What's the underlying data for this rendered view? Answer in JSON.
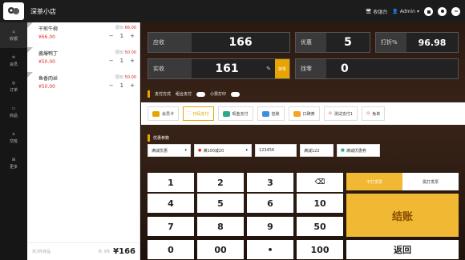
{
  "header": {
    "shop_name": "深茶小店",
    "right_items": [
      "收银台",
      "Admin"
    ]
  },
  "nav": [
    {
      "icon": "cashier-icon",
      "label": "收银"
    },
    {
      "icon": "member-icon",
      "label": "会员"
    },
    {
      "icon": "orders-icon",
      "label": "订单"
    },
    {
      "icon": "goods-icon",
      "label": "商品"
    },
    {
      "icon": "staff-icon",
      "label": "交班"
    },
    {
      "icon": "more-icon",
      "label": "更多"
    }
  ],
  "orders": {
    "items": [
      {
        "name": "干煎牛柳",
        "price": "¥66.00",
        "orig_label": "原价:",
        "orig_price": "66.00",
        "qty": "1"
      },
      {
        "name": "酱爆鸭丁",
        "price": "¥50.00",
        "orig_label": "原价:",
        "orig_price": "50.00",
        "qty": "1"
      },
      {
        "name": "鱼香肉丝",
        "price": "¥50.00",
        "orig_label": "原价:",
        "orig_price": "50.00",
        "qty": "1"
      }
    ],
    "footer_label": "共3件商品",
    "footer_count": "共 3件",
    "total": "¥166"
  },
  "summary": {
    "receivable_label": "应收",
    "receivable_value": "166",
    "discount_label": "优惠",
    "discount_value": "5",
    "rate_label": "打折%",
    "rate_value": "96.98",
    "received_label": "实收",
    "received_value": "161",
    "erase_label": "抹零",
    "change_label": "找零",
    "change_value": "0"
  },
  "payment": {
    "title": "支付方式",
    "combo_label": "组合支付",
    "small_label": "小票打印",
    "methods": [
      {
        "label": "会员卡",
        "color": "#e8a400",
        "active": false
      },
      {
        "label": "扫码支付",
        "color": "#e8a400",
        "active": true
      },
      {
        "label": "现金支付",
        "color": "#2aa98b",
        "active": false
      },
      {
        "label": "挂账",
        "color": "#3b8fe0",
        "active": false
      },
      {
        "label": "口碑券",
        "color": "#f3a623",
        "active": false
      },
      {
        "label": "测试支付1",
        "color": "#e02a2a",
        "active": false
      },
      {
        "label": "免单",
        "color": "#e02a2a",
        "active": false
      }
    ]
  },
  "params": {
    "title": "优惠参数",
    "items": [
      "满减优惠",
      "满100减20",
      "123456",
      "满减122",
      "满减优惠券"
    ]
  },
  "keypad": {
    "rows": [
      [
        "1",
        "2",
        "3",
        "⌫"
      ],
      [
        "4",
        "5",
        "6",
        "10"
      ],
      [
        "7",
        "8",
        "9",
        "50"
      ],
      [
        "0",
        "00",
        "•",
        "100"
      ]
    ]
  },
  "actions": {
    "print_no": "不打发票",
    "print_yes": "需打发票",
    "checkout": "结账",
    "back": "返回"
  },
  "colors": {
    "accent": "#f1b933",
    "price": "#e02a2a"
  }
}
